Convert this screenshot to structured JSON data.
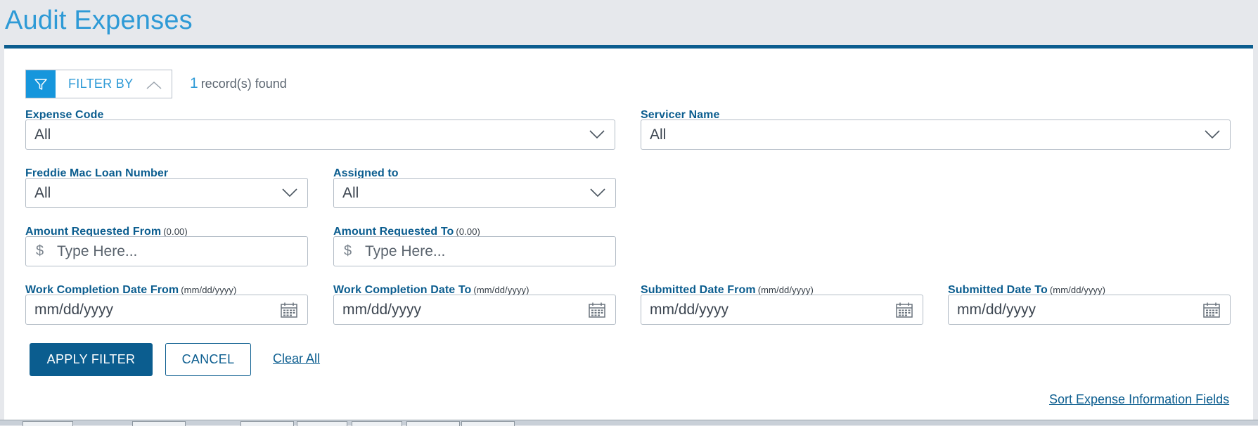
{
  "page": {
    "title": "Audit Expenses"
  },
  "filter": {
    "toggle_label": "FILTER BY",
    "records_count": "1",
    "records_text": "record(s) found"
  },
  "fields": {
    "expense_code": {
      "label": "Expense Code",
      "value": "All"
    },
    "servicer_name": {
      "label": "Servicer Name",
      "value": "All"
    },
    "loan_number": {
      "label": "Freddie Mac Loan Number",
      "value": "All"
    },
    "assigned_to": {
      "label": "Assigned to",
      "value": "All"
    },
    "amount_from": {
      "label": "Amount Requested From",
      "hint": "(0.00)",
      "currency": "$",
      "placeholder": "Type Here..."
    },
    "amount_to": {
      "label": "Amount Requested To",
      "hint": "(0.00)",
      "currency": "$",
      "placeholder": "Type Here..."
    },
    "work_date_from": {
      "label": "Work Completion Date From",
      "hint": "(mm/dd/yyyy)",
      "placeholder": "mm/dd/yyyy"
    },
    "work_date_to": {
      "label": "Work Completion Date To",
      "hint": "(mm/dd/yyyy)",
      "placeholder": "mm/dd/yyyy"
    },
    "submitted_from": {
      "label": "Submitted Date From",
      "hint": "(mm/dd/yyyy)",
      "placeholder": "mm/dd/yyyy"
    },
    "submitted_to": {
      "label": "Submitted Date To",
      "hint": "(mm/dd/yyyy)",
      "placeholder": "mm/dd/yyyy"
    }
  },
  "actions": {
    "apply": "APPLY FILTER",
    "cancel": "CANCEL",
    "clear": "Clear All",
    "sort_link": "Sort Expense Information Fields"
  },
  "icons": {
    "filter": "filter-funnel-icon",
    "collapse": "chevron-up-icon",
    "dropdown": "chevron-down-icon",
    "calendar": "calendar-icon"
  },
  "colors": {
    "brand_dark": "#0b5d8f",
    "brand_light": "#1696dc",
    "title": "#2e9ad6",
    "background": "#e6e8ec"
  }
}
